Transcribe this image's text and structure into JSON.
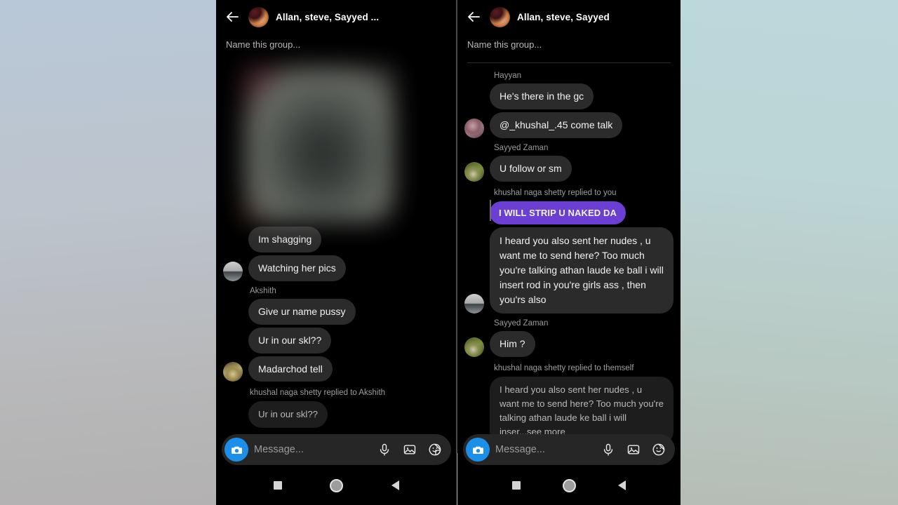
{
  "background": {
    "left_gradient": "#b9c8d8",
    "right_gradient": "#bcd8dc"
  },
  "colors": {
    "bubble": "#2b2b2b",
    "bubble_quoted": "#1d1d1d",
    "purple_bubble": "#6a3fd1",
    "camera_blue": "#1e8fe8",
    "panel_bg": "#000000"
  },
  "left_panel": {
    "header": {
      "back_icon": "back-arrow-icon",
      "avatar": "group-avatar",
      "title": "Allan, steve, Sayyed ..."
    },
    "name_group_placeholder": "Name this group...",
    "media": {
      "type": "blurred-image",
      "label": "censored-photo"
    },
    "messages": [
      {
        "kind": "bubble",
        "text": "Im shagging",
        "avatar": null
      },
      {
        "kind": "bubble",
        "text": "Watching her pics",
        "avatar": "gray"
      },
      {
        "kind": "sender",
        "text": "Akshith"
      },
      {
        "kind": "bubble",
        "text": "Give ur name pussy",
        "avatar": null
      },
      {
        "kind": "bubble",
        "text": "Ur in our skl??",
        "avatar": null
      },
      {
        "kind": "bubble",
        "text": "Madarchod tell",
        "avatar": "person"
      },
      {
        "kind": "reply-label",
        "text": "khushal naga shetty replied to Akshith"
      },
      {
        "kind": "quoted",
        "text": "Ur in our skl??"
      }
    ],
    "composer": {
      "camera_icon": "camera-icon",
      "placeholder": "Message...",
      "icons": [
        "microphone-icon",
        "gallery-icon",
        "sticker-icon"
      ]
    },
    "navbar": {
      "recents": "recents-square-icon",
      "home": "home-circle-icon",
      "back": "back-triangle-icon"
    }
  },
  "right_panel": {
    "header": {
      "back_icon": "back-arrow-icon",
      "avatar": "group-avatar",
      "title": "Allan, steve, Sayyed"
    },
    "name_group_placeholder": "Name this group...",
    "messages": [
      {
        "kind": "sender",
        "text": "Hayyan"
      },
      {
        "kind": "bubble",
        "text": "He's there in the gc",
        "avatar": null
      },
      {
        "kind": "bubble",
        "text": "@_khushal_.45 come talk",
        "avatar": "pink"
      },
      {
        "kind": "sender",
        "text": "Sayyed Zaman"
      },
      {
        "kind": "bubble",
        "text": "U follow or sm",
        "avatar": "green"
      },
      {
        "kind": "reply-label",
        "text": "khushal naga shetty replied to you"
      },
      {
        "kind": "purple",
        "text": "I WILL STRIP U NAKED DA"
      },
      {
        "kind": "bubble-multiline",
        "text": "I heard you also sent her nudes , u want me to send here? Too much you're talking athan laude ke ball i will insert rod in you're girls ass , then you'rs also",
        "avatar": "gray"
      },
      {
        "kind": "sender",
        "text": "Sayyed Zaman"
      },
      {
        "kind": "bubble",
        "text": "Him ?",
        "avatar": "green"
      },
      {
        "kind": "reply-label",
        "text": "khushal naga shetty replied to themself"
      },
      {
        "kind": "quoted",
        "text": "I heard you also sent her nudes , u want me to send here? Too much you're talking athan laude ke ball i will inser...see more"
      }
    ],
    "composer": {
      "camera_icon": "camera-icon",
      "placeholder": "Message...",
      "icons": [
        "microphone-icon",
        "gallery-icon",
        "sticker-icon"
      ]
    },
    "navbar": {
      "recents": "recents-square-icon",
      "home": "home-circle-icon",
      "back": "back-triangle-icon"
    }
  }
}
